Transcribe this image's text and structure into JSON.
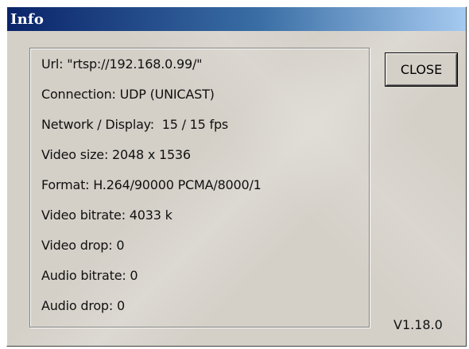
{
  "window": {
    "title": "Info"
  },
  "info": {
    "lines": [
      "Url: \"rtsp://192.168.0.99/\"",
      "Connection: UDP (UNICAST)",
      "Network / Display:  15 / 15 fps",
      "Video size: 2048 x 1536",
      "Format: H.264/90000 PCMA/8000/1",
      "Video bitrate: 4033 k",
      "Video drop: 0",
      "Audio bitrate: 0",
      "Audio drop: 0"
    ]
  },
  "close_label": "CLOSE",
  "version": "V1.18.0",
  "colors": {
    "titlebar_start": "#0a246a",
    "titlebar_end": "#a6caf0",
    "window_bg": "#d4d0c8"
  }
}
